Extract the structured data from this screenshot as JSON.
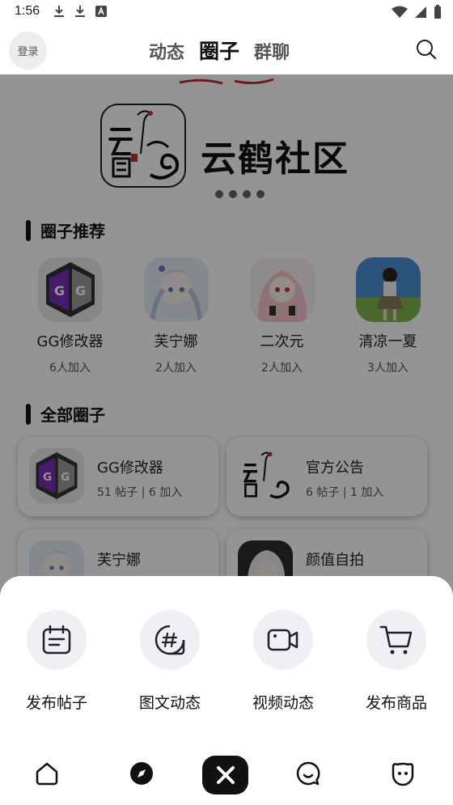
{
  "status_bar": {
    "time": "1:56",
    "left_icons": [
      "download-icon",
      "download-icon",
      "font-icon"
    ],
    "right_icons": [
      "wifi-icon",
      "signal-icon",
      "battery-icon"
    ]
  },
  "top_nav": {
    "login_label": "登录",
    "tabs": [
      {
        "label": "动态",
        "active": false
      },
      {
        "label": "圈子",
        "active": true
      },
      {
        "label": "群聊",
        "active": false
      }
    ],
    "search_icon": "search-icon"
  },
  "banner": {
    "title": "云鹤社区",
    "page_count": 4
  },
  "recommended": {
    "title": "圈子推荐",
    "items": [
      {
        "name": "GG修改器",
        "count": "6人加入"
      },
      {
        "name": "芙宁娜",
        "count": "2人加入"
      },
      {
        "name": "二次元",
        "count": "2人加入"
      },
      {
        "name": "清凉一夏",
        "count": "3人加入"
      }
    ]
  },
  "all_circles": {
    "title": "全部圈子",
    "items": [
      {
        "name": "GG修改器",
        "meta": "51 帖子 | 6 加入"
      },
      {
        "name": "官方公告",
        "meta": "6 帖子 | 1 加入"
      },
      {
        "name": "芙宁娜",
        "meta": ""
      },
      {
        "name": "颜值自拍",
        "meta": ""
      }
    ]
  },
  "sheet": {
    "actions": [
      {
        "label": "发布帖子",
        "icon": "calendar-icon"
      },
      {
        "label": "图文动态",
        "icon": "hashtag-icon"
      },
      {
        "label": "视频动态",
        "icon": "video-icon"
      },
      {
        "label": "发布商品",
        "icon": "cart-icon"
      }
    ]
  },
  "tabbar": {
    "icons": [
      "home-icon",
      "compass-icon",
      "close-icon",
      "chat-icon",
      "face-icon"
    ]
  },
  "colors": {
    "accent_dark": "#111111",
    "overlay": "rgba(0,0,0,0.42)",
    "action_bg": "#f0f0f4"
  }
}
